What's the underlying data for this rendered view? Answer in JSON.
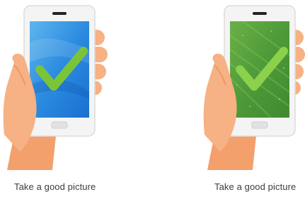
{
  "panels": [
    {
      "caption": "Take a good picture",
      "screen_pattern": "blue-water-texture",
      "screen_colors": [
        "#1a6fd0",
        "#5fb6ee"
      ],
      "check_color": "#7bc43a",
      "icon": "checkmark-icon"
    },
    {
      "caption": "Take a good picture",
      "screen_pattern": "green-leaf-texture",
      "screen_colors": [
        "#3f8a31",
        "#6bb047"
      ],
      "check_color": "#8bd14c",
      "icon": "checkmark-icon"
    }
  ],
  "colors": {
    "skin": "#f6b184",
    "skin_shadow": "#ea9a68",
    "sleeve": "#f3a06c",
    "phone_body": "#f4f4f4",
    "phone_edge": "#dcdcdc"
  }
}
